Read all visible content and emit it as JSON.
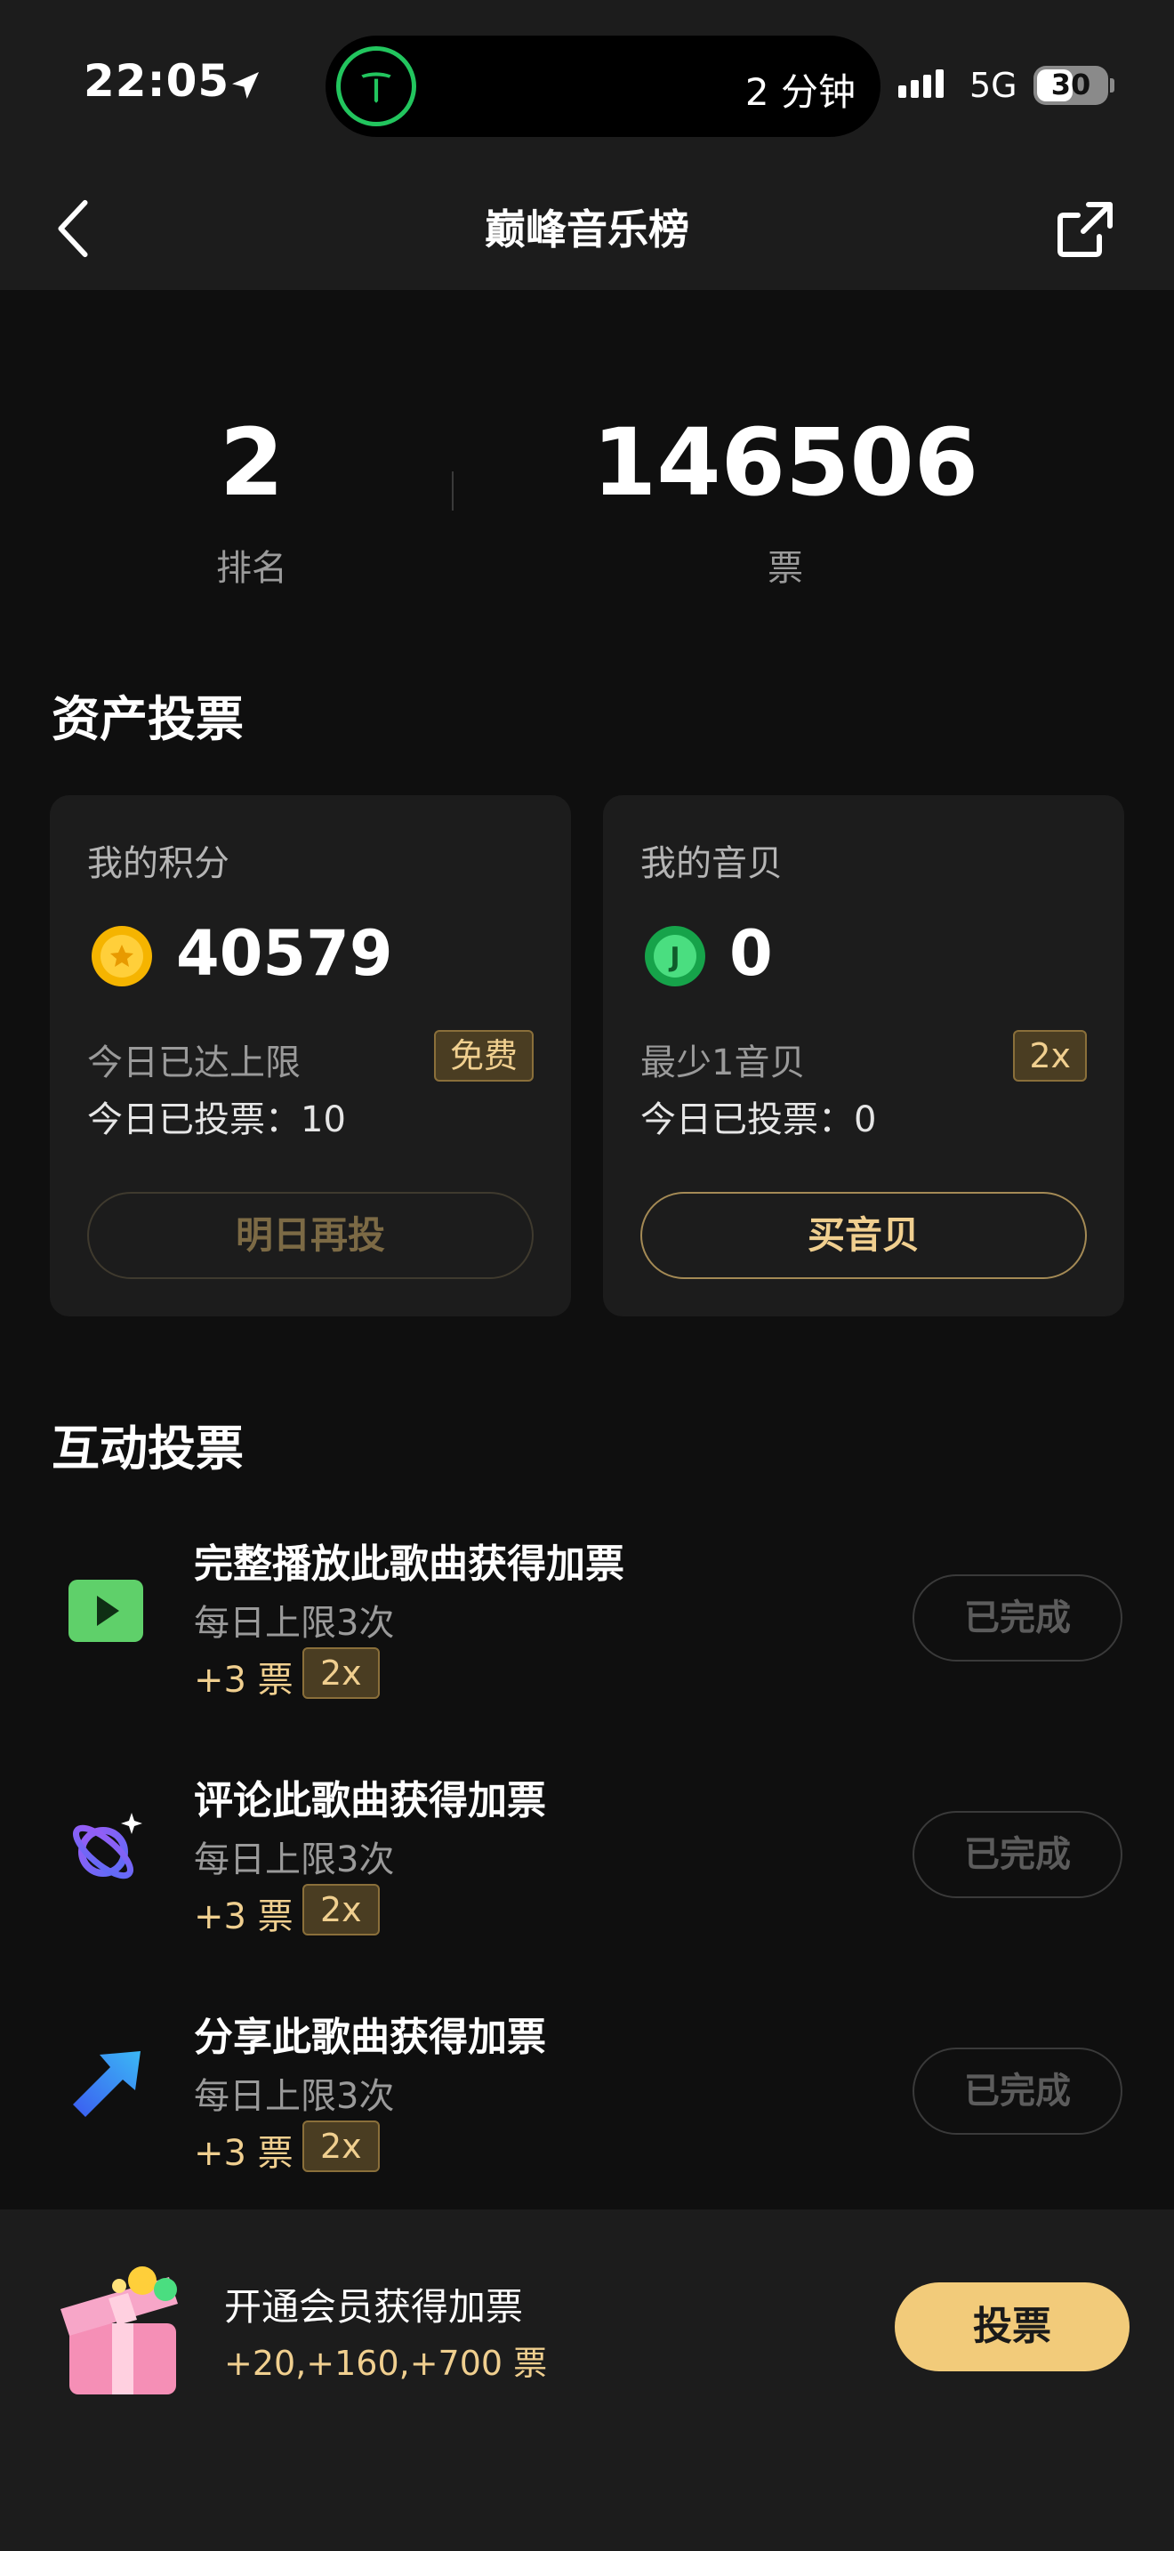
{
  "status_bar": {
    "time": "22:05",
    "live_activity_text": "2 分钟",
    "network": "5G",
    "battery": "30"
  },
  "nav": {
    "title": "巅峰音乐榜"
  },
  "stats": {
    "rank_value": "2",
    "rank_label": "排名",
    "votes_value": "146506",
    "votes_label": "票"
  },
  "asset_section": {
    "title": "资产投票",
    "points_card": {
      "label": "我的积分",
      "amount": "40579",
      "line1": "今日已达上限",
      "tag": "免费",
      "line2": "今日已投票：10",
      "button": "明日再投"
    },
    "shell_card": {
      "label": "我的音贝",
      "amount": "0",
      "line1": "最少1音贝",
      "tag": "2x",
      "line2": "今日已投票：0",
      "button": "买音贝"
    }
  },
  "interaction_section": {
    "title": "互动投票",
    "tasks": [
      {
        "title": "完整播放此歌曲获得加票",
        "sub": "每日上限3次",
        "bonus": "+3 票",
        "tag": "2x",
        "button": "已完成",
        "icon": "play-icon"
      },
      {
        "title": "评论此歌曲获得加票",
        "sub": "每日上限3次",
        "bonus": "+3 票",
        "tag": "2x",
        "button": "已完成",
        "icon": "planet-icon"
      },
      {
        "title": "分享此歌曲获得加票",
        "sub": "每日上限3次",
        "bonus": "+3 票",
        "tag": "2x",
        "button": "已完成",
        "icon": "share-arrow-icon"
      }
    ]
  },
  "bottom_bar": {
    "title": "开通会员获得加票",
    "sub": "+20,+160,+700 票",
    "vote_button": "投票"
  },
  "colors": {
    "accent_gold": "#f2cb7a",
    "tag_text": "#f0cf8f",
    "background": "#0f0f0f",
    "card": "#1c1c1c"
  }
}
